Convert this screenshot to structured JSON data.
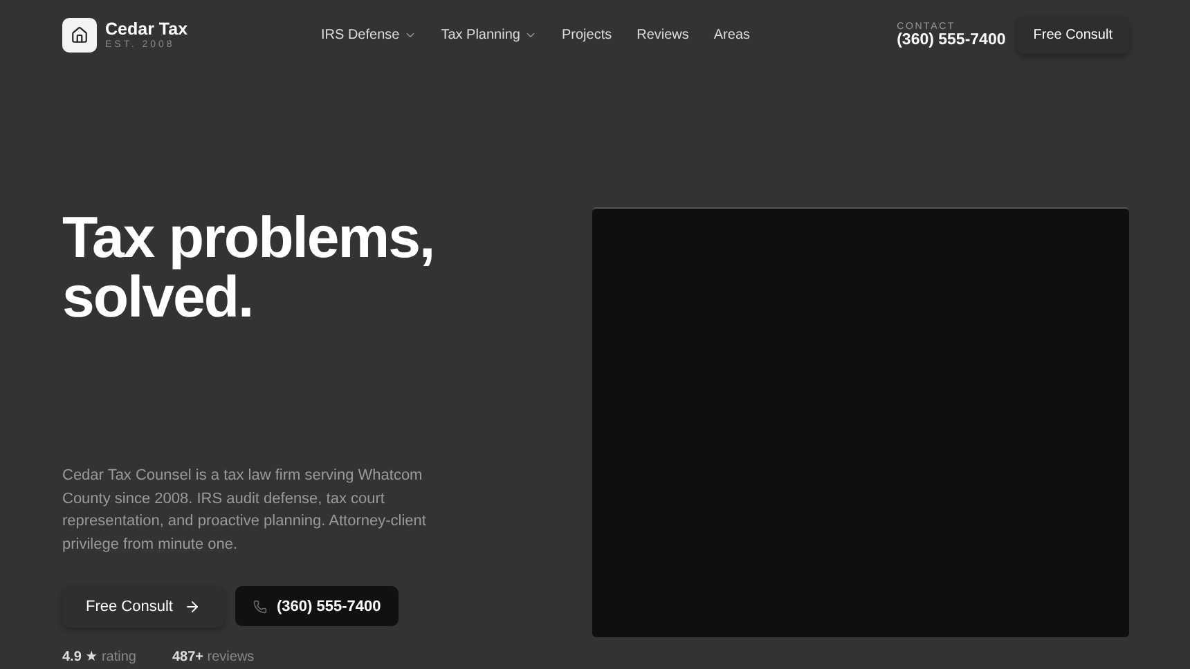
{
  "brand": {
    "name": "Cedar Tax",
    "tagline": "EST. 2008"
  },
  "nav": [
    {
      "label": "IRS Defense",
      "dropdown": true
    },
    {
      "label": "Tax Planning",
      "dropdown": true
    },
    {
      "label": "Projects",
      "dropdown": false
    },
    {
      "label": "Reviews",
      "dropdown": false
    },
    {
      "label": "Areas",
      "dropdown": false
    }
  ],
  "contact": {
    "label": "CONTACT",
    "phone": "(360) 555-7400"
  },
  "header_button": "Free Consult",
  "hero": {
    "title_lines": [
      "Tax problems,",
      "solved."
    ],
    "description": "Cedar Tax Counsel is a tax law firm serving Whatcom County since 2008. IRS audit defense, tax court representation, and proactive planning. Attorney-client privilege from minute one.",
    "primary_button": "Free Consult",
    "phone_button": "(360) 555-7400",
    "stats": [
      {
        "value": "4.9 ★",
        "label": "rating"
      },
      {
        "value": "487+",
        "label": "reviews"
      }
    ]
  }
}
